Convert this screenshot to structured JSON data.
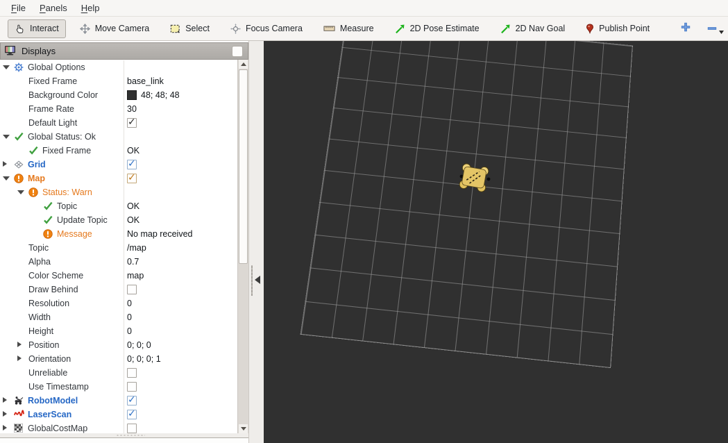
{
  "menu": {
    "items": [
      "File",
      "Panels",
      "Help"
    ]
  },
  "toolbar": {
    "tools": [
      {
        "id": "interact",
        "label": "Interact",
        "icon": "hand",
        "active": true
      },
      {
        "id": "move-camera",
        "label": "Move Camera",
        "icon": "move",
        "active": false
      },
      {
        "id": "select",
        "label": "Select",
        "icon": "select",
        "active": false
      },
      {
        "id": "focus-camera",
        "label": "Focus Camera",
        "icon": "focus",
        "active": false
      },
      {
        "id": "measure",
        "label": "Measure",
        "icon": "measure",
        "active": false
      },
      {
        "id": "2d-pose-estimate",
        "label": "2D Pose Estimate",
        "icon": "green-arrow",
        "active": false
      },
      {
        "id": "2d-nav-goal",
        "label": "2D Nav Goal",
        "icon": "green-arrow",
        "active": false
      },
      {
        "id": "publish-point",
        "label": "Publish Point",
        "icon": "pin",
        "active": false
      }
    ],
    "extra_buttons": [
      {
        "id": "add-tool",
        "icon": "plus",
        "caret": false
      },
      {
        "id": "remove-tool",
        "icon": "minus",
        "caret": true
      },
      {
        "id": "camera-type",
        "icon": "eye",
        "caret": true
      }
    ]
  },
  "displays": {
    "title": "Displays",
    "rows": [
      {
        "depth": 0,
        "expander": "open",
        "icon": "gear",
        "label": "Global Options",
        "style": "plain",
        "value": null
      },
      {
        "depth": 1,
        "expander": null,
        "icon": null,
        "label": "Fixed Frame",
        "style": "plain",
        "value": {
          "type": "text",
          "text": "base_link"
        }
      },
      {
        "depth": 1,
        "expander": null,
        "icon": null,
        "label": "Background Color",
        "style": "plain",
        "value": {
          "type": "swatch",
          "text": "48; 48; 48",
          "swatch": "#303030"
        }
      },
      {
        "depth": 1,
        "expander": null,
        "icon": null,
        "label": "Frame Rate",
        "style": "plain",
        "value": {
          "type": "text",
          "text": "30"
        }
      },
      {
        "depth": 1,
        "expander": null,
        "icon": null,
        "label": "Default Light",
        "style": "plain",
        "value": {
          "type": "check",
          "checked": true,
          "color": "dark"
        }
      },
      {
        "depth": 0,
        "expander": "open",
        "icon": "check",
        "label": "Global Status: Ok",
        "style": "plain",
        "value": null
      },
      {
        "depth": 1,
        "expander": null,
        "icon": "check",
        "label": "Fixed Frame",
        "style": "plain",
        "value": {
          "type": "text",
          "text": "OK"
        }
      },
      {
        "depth": 0,
        "expander": "closed",
        "icon": "grid",
        "label": "Grid",
        "style": "bold-blue",
        "value": {
          "type": "check",
          "checked": true,
          "color": "blue"
        }
      },
      {
        "depth": 0,
        "expander": "open",
        "icon": "warn",
        "label": "Map",
        "style": "bold-orange",
        "value": {
          "type": "check",
          "checked": true,
          "color": "orange"
        }
      },
      {
        "depth": 1,
        "expander": "open",
        "icon": "warn",
        "label": "Status: Warn",
        "style": "orange",
        "value": null
      },
      {
        "depth": 2,
        "expander": null,
        "icon": "check",
        "label": "Topic",
        "style": "plain",
        "value": {
          "type": "text",
          "text": "OK"
        }
      },
      {
        "depth": 2,
        "expander": null,
        "icon": "check",
        "label": "Update Topic",
        "style": "plain",
        "value": {
          "type": "text",
          "text": "OK"
        }
      },
      {
        "depth": 2,
        "expander": null,
        "icon": "warn",
        "label": "Message",
        "style": "orange",
        "value": {
          "type": "text",
          "text": "No map received"
        }
      },
      {
        "depth": 1,
        "expander": null,
        "icon": null,
        "label": "Topic",
        "style": "plain",
        "value": {
          "type": "text",
          "text": "/map"
        }
      },
      {
        "depth": 1,
        "expander": null,
        "icon": null,
        "label": "Alpha",
        "style": "plain",
        "value": {
          "type": "text",
          "text": "0.7"
        }
      },
      {
        "depth": 1,
        "expander": null,
        "icon": null,
        "label": "Color Scheme",
        "style": "plain",
        "value": {
          "type": "text",
          "text": "map"
        }
      },
      {
        "depth": 1,
        "expander": null,
        "icon": null,
        "label": "Draw Behind",
        "style": "plain",
        "value": {
          "type": "check",
          "checked": false,
          "color": "dark"
        }
      },
      {
        "depth": 1,
        "expander": null,
        "icon": null,
        "label": "Resolution",
        "style": "plain",
        "value": {
          "type": "text",
          "text": "0"
        }
      },
      {
        "depth": 1,
        "expander": null,
        "icon": null,
        "label": "Width",
        "style": "plain",
        "value": {
          "type": "text",
          "text": "0"
        }
      },
      {
        "depth": 1,
        "expander": null,
        "icon": null,
        "label": "Height",
        "style": "plain",
        "value": {
          "type": "text",
          "text": "0"
        }
      },
      {
        "depth": 1,
        "expander": "closed",
        "icon": null,
        "label": "Position",
        "style": "plain",
        "value": {
          "type": "text",
          "text": "0; 0; 0"
        }
      },
      {
        "depth": 1,
        "expander": "closed",
        "icon": null,
        "label": "Orientation",
        "style": "plain",
        "value": {
          "type": "text",
          "text": "0; 0; 0; 1"
        }
      },
      {
        "depth": 1,
        "expander": null,
        "icon": null,
        "label": "Unreliable",
        "style": "plain",
        "value": {
          "type": "check",
          "checked": false,
          "color": "dark"
        }
      },
      {
        "depth": 1,
        "expander": null,
        "icon": null,
        "label": "Use Timestamp",
        "style": "plain",
        "value": {
          "type": "check",
          "checked": false,
          "color": "dark"
        }
      },
      {
        "depth": 0,
        "expander": "closed",
        "icon": "robot",
        "label": "RobotModel",
        "style": "bold-blue",
        "value": {
          "type": "check",
          "checked": true,
          "color": "blue"
        }
      },
      {
        "depth": 0,
        "expander": "closed",
        "icon": "laser",
        "label": "LaserScan",
        "style": "bold-blue",
        "value": {
          "type": "check",
          "checked": true,
          "color": "blue"
        }
      },
      {
        "depth": 0,
        "expander": "closed",
        "icon": "costmap",
        "label": "GlobalCostMap",
        "style": "plain",
        "value": {
          "type": "check",
          "checked": false,
          "color": "dark"
        }
      }
    ]
  },
  "viewport": {
    "background_color": "#303030",
    "grid_color": "#a2a2a2",
    "grid_cells": "10x10",
    "robot_body_color": "#e4c566",
    "robot_wheel_color": "#edd27a"
  }
}
